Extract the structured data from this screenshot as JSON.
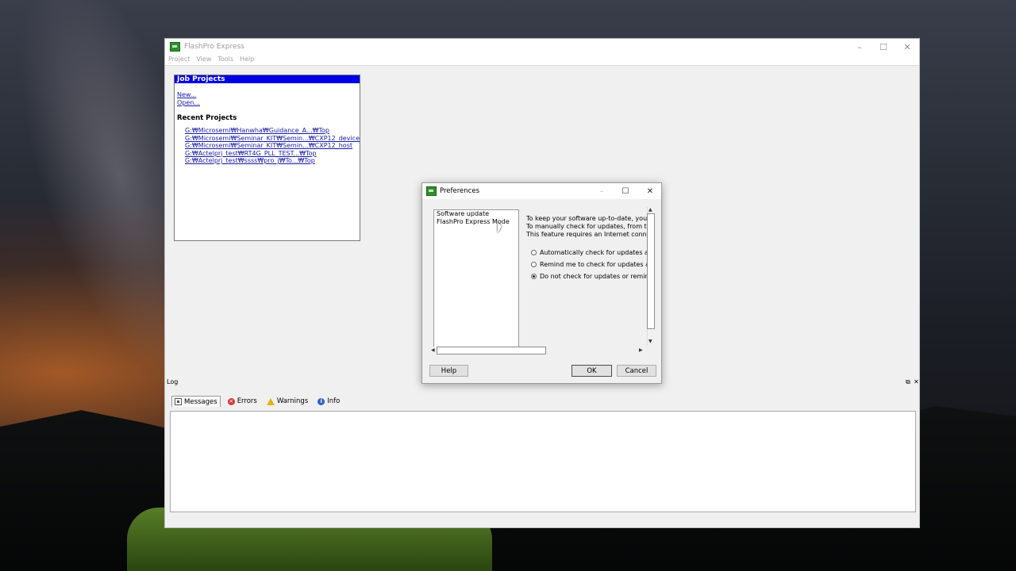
{
  "main_window": {
    "title": "FlashPro Express",
    "controls": {
      "minimize": "–",
      "maximize": "☐",
      "close": "✕"
    },
    "menu": [
      "Project",
      "View",
      "Tools",
      "Help"
    ]
  },
  "job_projects": {
    "header": "Job Projects",
    "links": [
      "New...",
      "Open..."
    ],
    "recent_title": "Recent Projects",
    "recent": [
      "G:₩Microsemi₩Hanwha₩Guidance_A...₩Top",
      "G:₩Microsemi₩Seminar_KIT₩Semin...₩CXP12_device",
      "G:₩Microsemi₩Seminar_KIT₩Semin...₩CXP12_host",
      "G:₩Actelprj_test₩RT4G_PLL_TEST...₩Top",
      "G:₩Actelprj_test₩ssss₩pro_j₩To...₩Top"
    ]
  },
  "log": {
    "title": "Log",
    "tabs": [
      {
        "label": "Messages",
        "icon": "messages-icon",
        "active": true
      },
      {
        "label": "Errors",
        "icon": "error-icon",
        "active": false
      },
      {
        "label": "Warnings",
        "icon": "warning-icon",
        "active": false
      },
      {
        "label": "Info",
        "icon": "info-icon",
        "active": false
      }
    ]
  },
  "preferences": {
    "title": "Preferences",
    "tree": [
      "Software update",
      "FlashPro Express Mode"
    ],
    "description": [
      "To keep your software up-to-date, you c",
      "To manually check for updates, from the",
      "This feature requires an Internet connect"
    ],
    "options": [
      {
        "label": "Automatically check for updates at s",
        "selected": false
      },
      {
        "label": "Remind me to check for updates at",
        "selected": false
      },
      {
        "label": "Do not check for updates or remind",
        "selected": true
      }
    ],
    "buttons": {
      "help": "Help",
      "ok": "OK",
      "cancel": "Cancel"
    }
  }
}
